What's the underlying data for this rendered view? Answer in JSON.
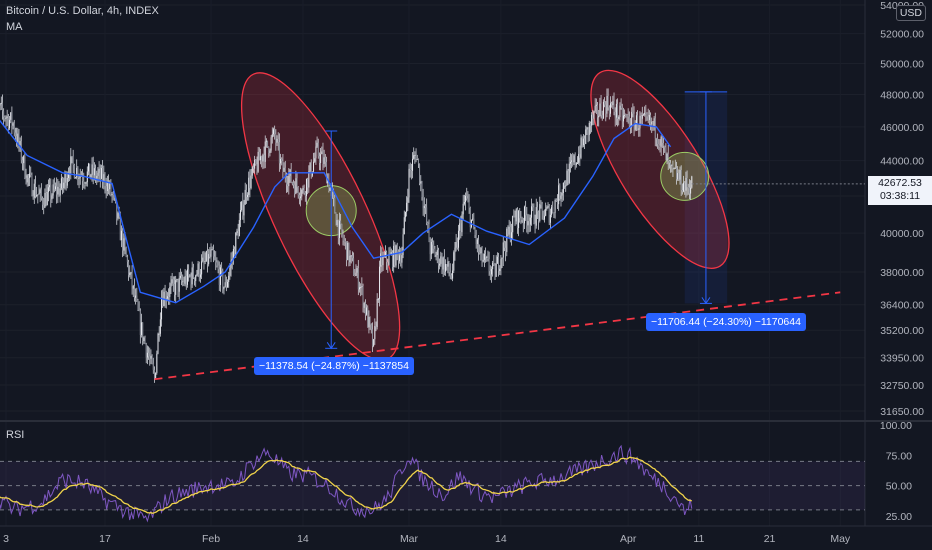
{
  "header": {
    "symbol": "Bitcoin / U.S. Dollar, 4h, INDEX",
    "indicator": "MA",
    "rsi_label": "RSI",
    "currency": "USD"
  },
  "price_tag": {
    "price": "42672.53",
    "countdown": "03:38:11"
  },
  "measure_labels": [
    {
      "text": "−11378.54 (−24.87%) −1137854"
    },
    {
      "text": "−11706.44 (−24.30%) −1170644"
    }
  ],
  "colors": {
    "background": "#131722",
    "candles": "#cfd2d9",
    "moving_average": "#2962ff",
    "rsi_line": "#7e57c2",
    "rsi_ma": "#f0d34a",
    "trendline": "#f23645",
    "ellipse_fill": "#f23645",
    "circle_fill": "#9ccc65",
    "measure_label": "#2962ff"
  },
  "chart_data": [
    {
      "type": "candlestick",
      "title": "Bitcoin / U.S. Dollar, 4h, INDEX",
      "y_axis_ticks": [
        54000,
        52000,
        50000,
        48000,
        46000,
        44000,
        42000,
        40000,
        38000,
        36400,
        35200,
        33950,
        32750,
        31650
      ],
      "x_axis_ticks": [
        "3",
        "17",
        "Feb",
        "14",
        "Mar",
        "14",
        "Apr",
        "11",
        "21",
        "May"
      ],
      "ylim": [
        31300,
        54300
      ],
      "y_scale": "log",
      "last_price": 42672.53,
      "price_path": [
        [
          "Jan 1",
          47500
        ],
        [
          "Jan 4",
          46200
        ],
        [
          "Jan 6",
          43000
        ],
        [
          "Jan 8",
          41800
        ],
        [
          "Jan 11",
          42500
        ],
        [
          "Jan 12",
          43800
        ],
        [
          "Jan 14",
          43100
        ],
        [
          "Jan 15",
          43300
        ],
        [
          "Jan 17",
          42900
        ],
        [
          "Jan 18",
          42000
        ],
        [
          "Jan 21",
          37000
        ],
        [
          "Jan 22",
          35400
        ],
        [
          "Jan 24",
          33000
        ],
        [
          "Jan 25",
          36800
        ],
        [
          "Jan 28",
          37500
        ],
        [
          "Jan 30",
          38000
        ],
        [
          "Feb 1",
          38800
        ],
        [
          "Feb 3",
          37200
        ],
        [
          "Feb 4",
          38700
        ],
        [
          "Feb 6",
          42400
        ],
        [
          "Feb 8",
          44200
        ],
        [
          "Feb 10",
          45500
        ],
        [
          "Feb 11",
          43500
        ],
        [
          "Feb 14",
          42200
        ],
        [
          "Feb 16",
          44500
        ],
        [
          "Feb 17",
          43900
        ],
        [
          "Feb 19",
          40300
        ],
        [
          "Feb 21",
          38300
        ],
        [
          "Feb 22",
          37500
        ],
        [
          "Feb 24",
          34350
        ],
        [
          "Feb 25",
          38500
        ],
        [
          "Feb 28",
          39000
        ],
        [
          "Mar 1",
          43200
        ],
        [
          "Mar 2",
          44500
        ],
        [
          "Mar 4",
          39200
        ],
        [
          "Mar 6",
          38400
        ],
        [
          "Mar 7",
          37800
        ],
        [
          "Mar 9",
          41900
        ],
        [
          "Mar 11",
          38800
        ],
        [
          "Mar 13",
          37900
        ],
        [
          "Mar 16",
          40800
        ],
        [
          "Mar 18",
          40900
        ],
        [
          "Mar 21",
          41100
        ],
        [
          "Mar 23",
          42800
        ],
        [
          "Mar 25",
          44400
        ],
        [
          "Mar 27",
          46500
        ],
        [
          "Mar 29",
          47500
        ],
        [
          "Mar 31",
          46600
        ],
        [
          "Apr 2",
          46300
        ],
        [
          "Apr 4",
          46200
        ],
        [
          "Apr 5",
          45800
        ],
        [
          "Apr 7",
          43300
        ],
        [
          "Apr 8",
          43100
        ],
        [
          "Apr 9",
          42500
        ],
        [
          "Apr 10",
          42673
        ]
      ],
      "moving_average_path": [
        [
          "Jan 1",
          47000
        ],
        [
          "Jan 6",
          44300
        ],
        [
          "Jan 11",
          43300
        ],
        [
          "Jan 14",
          43100
        ],
        [
          "Jan 18",
          42700
        ],
        [
          "Jan 20",
          39700
        ],
        [
          "Jan 22",
          37000
        ],
        [
          "Jan 27",
          36500
        ],
        [
          "Jan 31",
          37300
        ],
        [
          "Feb 3",
          38000
        ],
        [
          "Feb 7",
          40300
        ],
        [
          "Feb 10",
          42500
        ],
        [
          "Feb 12",
          43300
        ],
        [
          "Feb 17",
          43300
        ],
        [
          "Feb 21",
          40300
        ],
        [
          "Feb 24",
          38700
        ],
        [
          "Feb 28",
          39000
        ],
        [
          "Mar 3",
          40000
        ],
        [
          "Mar 7",
          41000
        ],
        [
          "Mar 12",
          40100
        ],
        [
          "Mar 18",
          39400
        ],
        [
          "Mar 23",
          40800
        ],
        [
          "Mar 27",
          43100
        ],
        [
          "Mar 30",
          45300
        ],
        [
          "Apr 2",
          46200
        ],
        [
          "Apr 5",
          46000
        ],
        [
          "Apr 7",
          44800
        ]
      ],
      "trendline": {
        "from": [
          "Jan 24",
          33000
        ],
        "to": [
          "May 1",
          37000
        ],
        "style": "dashed"
      },
      "measurements": [
        {
          "from_price": 45750,
          "to_price": 34371.46,
          "change": -11378.54,
          "percent": -24.87
        },
        {
          "from_price": 48170,
          "to_price": 36463.56,
          "change": -11706.44,
          "percent": -24.3
        }
      ],
      "annotations": [
        "red ellipse around Feb 11–Feb 24 decline",
        "red ellipse around Mar 28–Apr 12 decline",
        "green circles at Feb 18 and Apr 9"
      ]
    },
    {
      "type": "line",
      "title": "RSI",
      "y_axis_ticks": [
        100.0,
        75.0,
        50.0,
        25.0
      ],
      "ylim": [
        15,
        100
      ],
      "bands": {
        "upper": 70,
        "middle": 50,
        "lower": 30
      },
      "rsi_path": [
        [
          "Jan 1",
          45
        ],
        [
          "Jan 4",
          30
        ],
        [
          "Jan 8",
          36
        ],
        [
          "Jan 11",
          55
        ],
        [
          "Jan 14",
          52
        ],
        [
          "Jan 17",
          38
        ],
        [
          "Jan 21",
          26
        ],
        [
          "Jan 23",
          22
        ],
        [
          "Jan 26",
          40
        ],
        [
          "Jan 29",
          46
        ],
        [
          "Feb 1",
          51
        ],
        [
          "Feb 4",
          50
        ],
        [
          "Feb 7",
          70
        ],
        [
          "Feb 9",
          78
        ],
        [
          "Feb 12",
          60
        ],
        [
          "Feb 15",
          58
        ],
        [
          "Feb 18",
          48
        ],
        [
          "Feb 21",
          32
        ],
        [
          "Feb 24",
          30
        ],
        [
          "Feb 26",
          40
        ],
        [
          "Mar 1",
          76
        ],
        [
          "Mar 3",
          55
        ],
        [
          "Mar 6",
          42
        ],
        [
          "Mar 8",
          58
        ],
        [
          "Mar 11",
          44
        ],
        [
          "Mar 13",
          40
        ],
        [
          "Mar 18",
          52
        ],
        [
          "Mar 22",
          56
        ],
        [
          "Mar 25",
          62
        ],
        [
          "Mar 28",
          70
        ],
        [
          "Mar 31",
          77
        ],
        [
          "Apr 2",
          72
        ],
        [
          "Apr 4",
          58
        ],
        [
          "Apr 6",
          50
        ],
        [
          "Apr 8",
          38
        ],
        [
          "Apr 9",
          28
        ],
        [
          "Apr 10",
          35
        ]
      ]
    }
  ]
}
